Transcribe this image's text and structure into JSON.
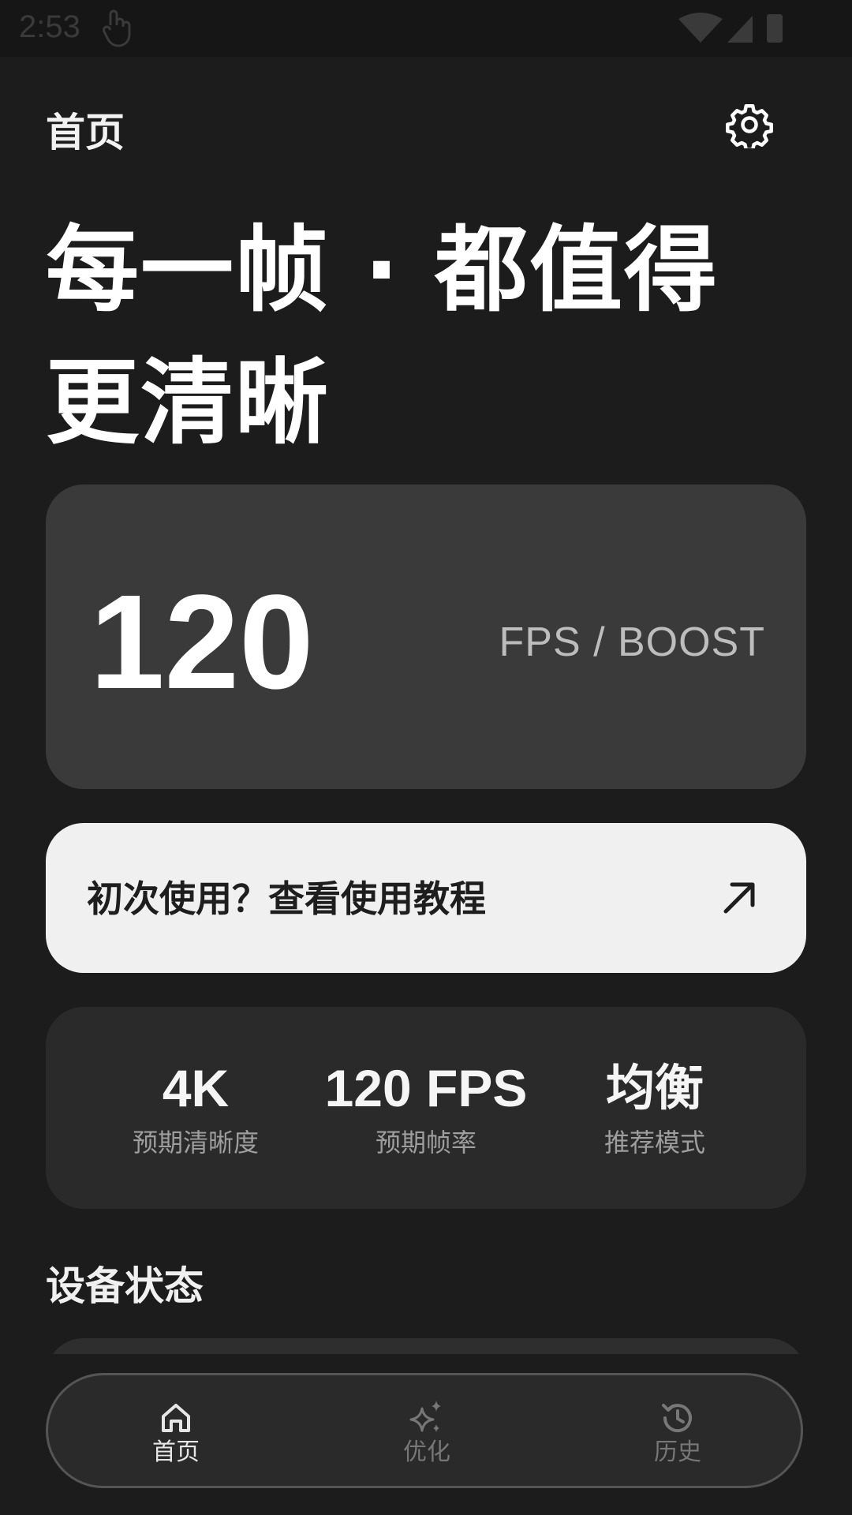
{
  "status_bar": {
    "time": "2:53"
  },
  "header": {
    "title": "首页",
    "settings_icon": "gear-icon"
  },
  "headline": {
    "line1": "每一帧 · 都值得",
    "line2": "更清晰"
  },
  "fps_card": {
    "value": "120",
    "label": "FPS / BOOST"
  },
  "tutorial": {
    "text": "初次使用？查看使用教程",
    "icon": "arrow-up-right-icon"
  },
  "stats": [
    {
      "value": "4K",
      "label": "预期清晰度"
    },
    {
      "value": "120 FPS",
      "label": "预期帧率"
    },
    {
      "value": "均衡",
      "label": "推荐模式"
    }
  ],
  "section": {
    "device_status": "设备状态"
  },
  "bottom_nav": {
    "items": [
      {
        "label": "首页",
        "icon": "home-icon",
        "active": true
      },
      {
        "label": "优化",
        "icon": "sparkles-icon",
        "active": false
      },
      {
        "label": "历史",
        "icon": "history-icon",
        "active": false
      }
    ]
  },
  "colors": {
    "background": "#1c1c1c",
    "card_dark": "#3a3a3a",
    "card_light": "#f0f0f0",
    "stats_card": "#2a2a2a",
    "text_primary": "#ffffff",
    "text_secondary": "#9e9e9e",
    "nav_inactive": "#777777"
  }
}
